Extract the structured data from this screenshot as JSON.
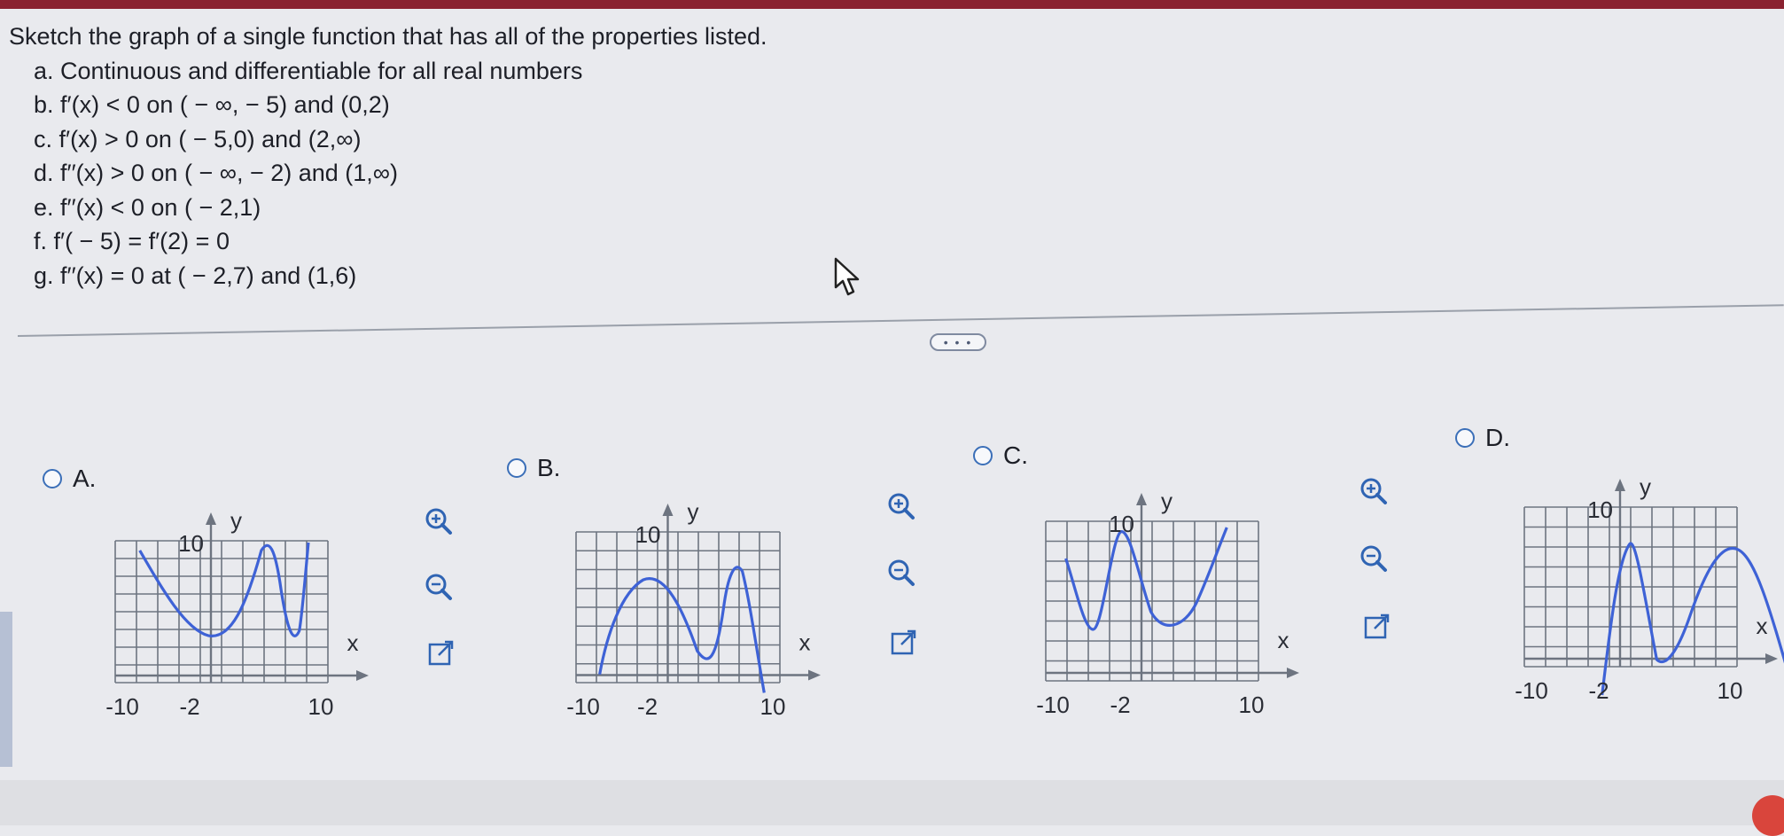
{
  "question": {
    "prompt": "Sketch the graph of a single function that has all of the properties listed.",
    "properties": [
      "a. Continuous and differentiable for all real numbers",
      "b. f′(x) < 0 on ( − ∞, − 5) and (0,2)",
      "c. f′(x) > 0 on ( − 5,0) and (2,∞)",
      "d. f′′(x) > 0 on ( − ∞, − 2) and (1,∞)",
      "e. f′′(x) < 0 on ( − 2,1)",
      "f. f′( − 5) = f′(2) = 0",
      "g. f′′(x) = 0 at ( − 2,7) and (1,6)"
    ]
  },
  "more_button": "• • •",
  "options": [
    {
      "label": "A.",
      "xlabel": "x",
      "ylabel": "y",
      "y_tick": "10",
      "x_ticks": [
        "-10",
        "-2",
        "10"
      ]
    },
    {
      "label": "B.",
      "xlabel": "x",
      "ylabel": "y",
      "y_tick": "10",
      "x_ticks": [
        "-10",
        "-2",
        "10"
      ]
    },
    {
      "label": "C.",
      "xlabel": "x",
      "ylabel": "y",
      "y_tick": "10",
      "x_ticks": [
        "-10",
        "-2",
        "10"
      ]
    },
    {
      "label": "D.",
      "xlabel": "x",
      "ylabel": "y",
      "y_tick": "10",
      "x_ticks": [
        "-10",
        "-2",
        "10"
      ]
    }
  ],
  "tool_icons": [
    "zoom-in-icon",
    "zoom-out-icon",
    "open-external-icon"
  ],
  "colors": {
    "curve": "#3e62d6",
    "grid": "#6d7480",
    "radio": "#3b6fb8",
    "header_bar": "#8a2231"
  }
}
